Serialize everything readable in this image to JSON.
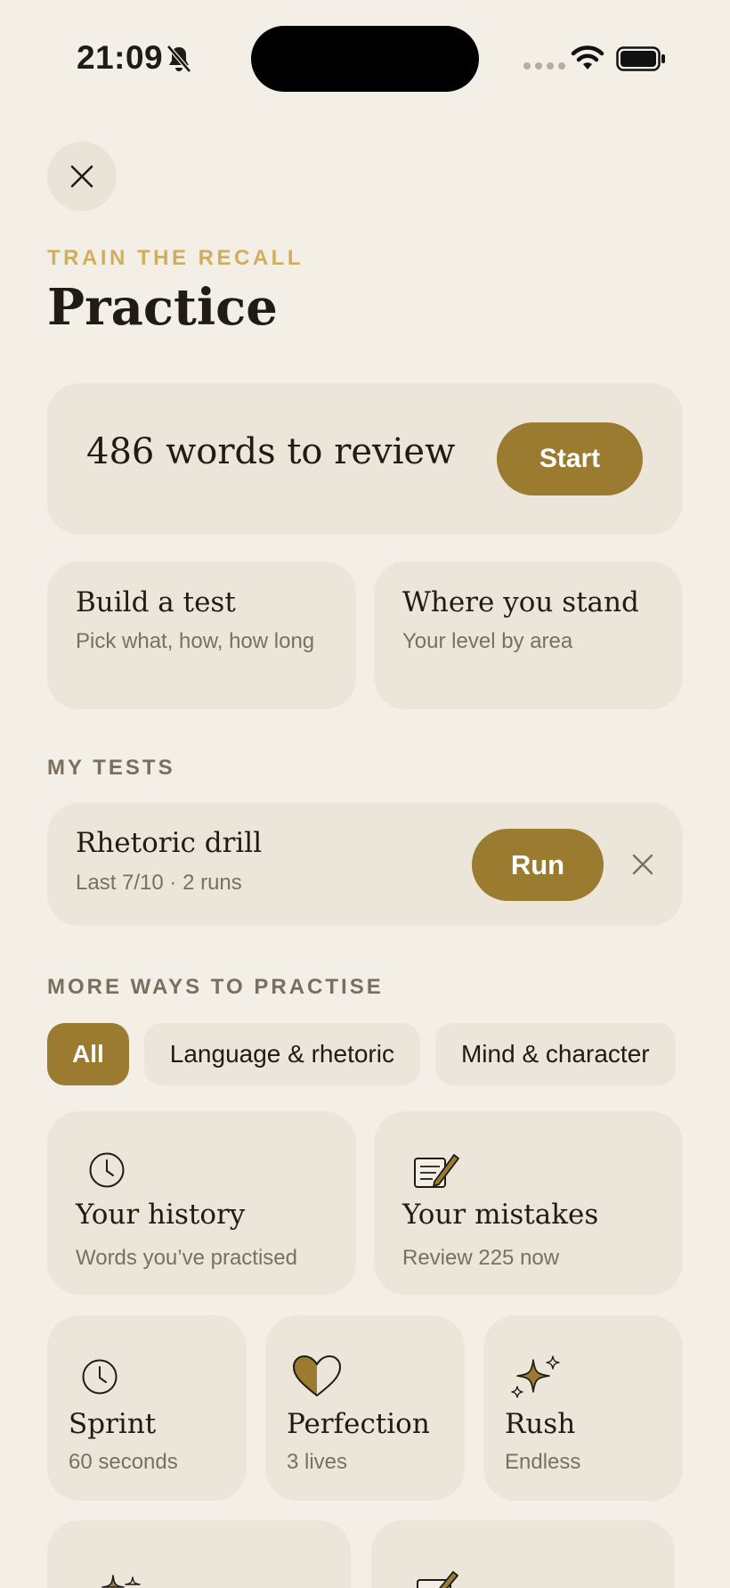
{
  "status_bar": {
    "time": "21:09"
  },
  "header": {
    "eyebrow": "TRAIN THE RECALL",
    "title": "Practice"
  },
  "review": {
    "text": "486 words to review",
    "start_label": "Start"
  },
  "quick_actions": [
    {
      "title": "Build a test",
      "subtitle": "Pick what, how, how long"
    },
    {
      "title": "Where you stand",
      "subtitle": "Your level by area"
    }
  ],
  "my_tests": {
    "label": "MY TESTS",
    "items": [
      {
        "title": "Rhetoric drill",
        "subtitle": "Last 7/10 · 2 runs",
        "run_label": "Run"
      }
    ]
  },
  "more_ways": {
    "label": "MORE WAYS TO PRACTISE",
    "filters": [
      "All",
      "Language & rhetoric",
      "Mind & character"
    ],
    "selected_filter": "All"
  },
  "modes_large": [
    {
      "icon": "clock-icon",
      "title": "Your history",
      "subtitle": "Words you’ve practised"
    },
    {
      "icon": "notepad-pencil-icon",
      "title": "Your mistakes",
      "subtitle": "Review 225 now"
    }
  ],
  "modes_small": [
    {
      "icon": "clock-icon",
      "title": "Sprint",
      "subtitle": "60 seconds"
    },
    {
      "icon": "half-heart-icon",
      "title": "Perfection",
      "subtitle": "3 lives"
    },
    {
      "icon": "sparkle-icon",
      "title": "Rush",
      "subtitle": "Endless"
    }
  ],
  "colors": {
    "background": "#f3efe7",
    "card": "#ebe5da",
    "accent": "#9b7b2f",
    "eyebrow": "#cfae5e",
    "muted_text": "#7a7062"
  }
}
